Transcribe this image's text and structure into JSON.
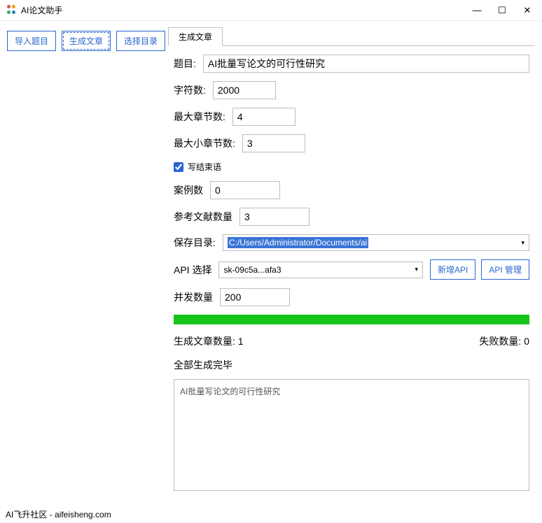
{
  "window": {
    "title": "AI论文助手"
  },
  "toolbar": {
    "import_topic": "导入题目",
    "generate_article": "生成文章",
    "select_directory": "选择目录"
  },
  "tab": {
    "generate_article": "生成文章"
  },
  "form": {
    "title_label": "题目:",
    "title_value": "AI批量写论文的可行性研究",
    "charcount_label": "字符数:",
    "charcount_value": "2000",
    "max_chapter_label": "最大章节数:",
    "max_chapter_value": "4",
    "max_subchapter_label": "最大小章节数:",
    "max_subchapter_value": "3",
    "write_conclusion_label": "写结束语",
    "case_count_label": "案例数",
    "case_count_value": "0",
    "ref_count_label": "参考文献数量",
    "ref_count_value": "3",
    "save_dir_label": "保存目录:",
    "save_dir_value": "C:/Users/Administrator/Documents/ai",
    "api_select_label": "API 选择",
    "api_select_value": "sk-09c5a...afa3",
    "add_api_btn": "新增API",
    "manage_api_btn": "API 管理",
    "concurrency_label": "并发数量",
    "concurrency_value": "200"
  },
  "status": {
    "generated_label": "生成文章数量:",
    "generated_count": "1",
    "failed_label": "失败数量:",
    "failed_count": "0",
    "done_text": "全部生成完毕",
    "log_line1": "AI批量写论文的可行性研究"
  },
  "footer": {
    "text": "AI飞升社区 - aifeisheng.com"
  }
}
